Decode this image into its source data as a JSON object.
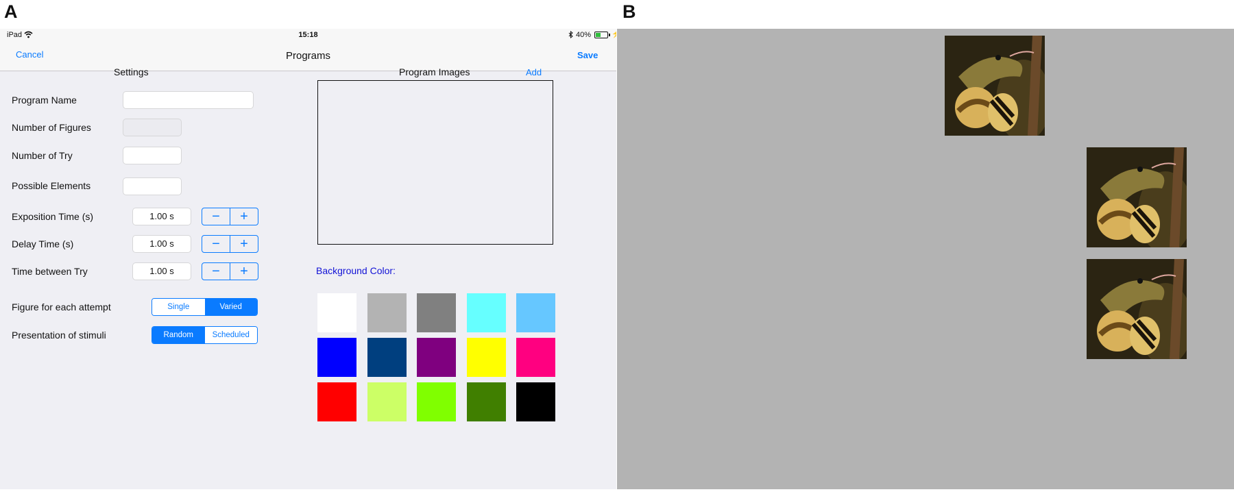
{
  "panels": {
    "a": "A",
    "b": "B"
  },
  "status_bar": {
    "device": "iPad",
    "time": "15:18",
    "battery": "40%"
  },
  "nav": {
    "cancel": "Cancel",
    "title": "Programs",
    "save": "Save"
  },
  "settings": {
    "heading": "Settings",
    "program_name": {
      "label": "Program Name",
      "value": ""
    },
    "number_of_figures": {
      "label": "Number of Figures",
      "value": ""
    },
    "number_of_try": {
      "label": "Number of Try",
      "value": ""
    },
    "possible_elements": {
      "label": "Possible Elements",
      "value": ""
    },
    "exposition_time": {
      "label": "Exposition Time (s)",
      "value": "1.00 s"
    },
    "delay_time": {
      "label": "Delay Time (s)",
      "value": "1.00 s"
    },
    "time_between_try": {
      "label": "Time between Try",
      "value": "1.00 s"
    },
    "figure_each_attempt": {
      "label": "Figure for each attempt",
      "options": [
        "Single",
        "Varied"
      ],
      "selected": "Varied"
    },
    "presentation_stimuli": {
      "label": "Presentation of stimuli",
      "options": [
        "Random",
        "Scheduled"
      ],
      "selected": "Random"
    }
  },
  "program_images": {
    "heading": "Program Images",
    "add": "Add"
  },
  "background_color": {
    "label": "Background Color:",
    "swatches": [
      "#ffffff",
      "#b3b3b3",
      "#808080",
      "#66ffff",
      "#66c7ff",
      "#0000ff",
      "#003f7f",
      "#7f007f",
      "#ffff00",
      "#ff0080",
      "#ff0000",
      "#ccff66",
      "#80ff00",
      "#407f00",
      "#000000"
    ]
  },
  "accent_color": "#0a7bff",
  "stimulus_panel": {
    "background": "#b3b3b3",
    "images": [
      "snake-image",
      "snake-image",
      "snake-image"
    ]
  }
}
